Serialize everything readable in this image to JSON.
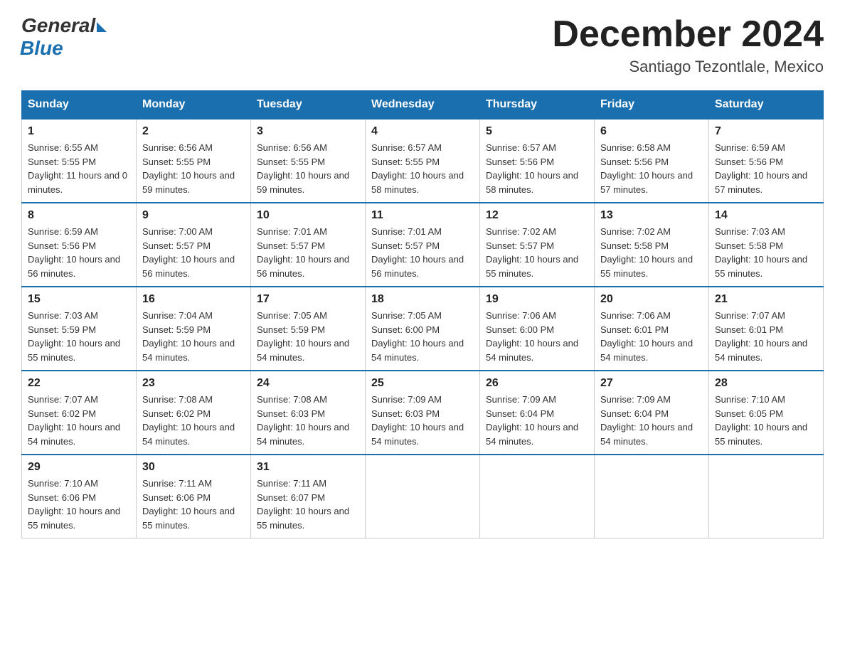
{
  "logo": {
    "general": "General",
    "blue": "Blue"
  },
  "title": "December 2024",
  "location": "Santiago Tezontlale, Mexico",
  "days_of_week": [
    "Sunday",
    "Monday",
    "Tuesday",
    "Wednesday",
    "Thursday",
    "Friday",
    "Saturday"
  ],
  "weeks": [
    [
      {
        "day": "1",
        "sunrise": "6:55 AM",
        "sunset": "5:55 PM",
        "daylight": "11 hours and 0 minutes."
      },
      {
        "day": "2",
        "sunrise": "6:56 AM",
        "sunset": "5:55 PM",
        "daylight": "10 hours and 59 minutes."
      },
      {
        "day": "3",
        "sunrise": "6:56 AM",
        "sunset": "5:55 PM",
        "daylight": "10 hours and 59 minutes."
      },
      {
        "day": "4",
        "sunrise": "6:57 AM",
        "sunset": "5:55 PM",
        "daylight": "10 hours and 58 minutes."
      },
      {
        "day": "5",
        "sunrise": "6:57 AM",
        "sunset": "5:56 PM",
        "daylight": "10 hours and 58 minutes."
      },
      {
        "day": "6",
        "sunrise": "6:58 AM",
        "sunset": "5:56 PM",
        "daylight": "10 hours and 57 minutes."
      },
      {
        "day": "7",
        "sunrise": "6:59 AM",
        "sunset": "5:56 PM",
        "daylight": "10 hours and 57 minutes."
      }
    ],
    [
      {
        "day": "8",
        "sunrise": "6:59 AM",
        "sunset": "5:56 PM",
        "daylight": "10 hours and 56 minutes."
      },
      {
        "day": "9",
        "sunrise": "7:00 AM",
        "sunset": "5:57 PM",
        "daylight": "10 hours and 56 minutes."
      },
      {
        "day": "10",
        "sunrise": "7:01 AM",
        "sunset": "5:57 PM",
        "daylight": "10 hours and 56 minutes."
      },
      {
        "day": "11",
        "sunrise": "7:01 AM",
        "sunset": "5:57 PM",
        "daylight": "10 hours and 56 minutes."
      },
      {
        "day": "12",
        "sunrise": "7:02 AM",
        "sunset": "5:57 PM",
        "daylight": "10 hours and 55 minutes."
      },
      {
        "day": "13",
        "sunrise": "7:02 AM",
        "sunset": "5:58 PM",
        "daylight": "10 hours and 55 minutes."
      },
      {
        "day": "14",
        "sunrise": "7:03 AM",
        "sunset": "5:58 PM",
        "daylight": "10 hours and 55 minutes."
      }
    ],
    [
      {
        "day": "15",
        "sunrise": "7:03 AM",
        "sunset": "5:59 PM",
        "daylight": "10 hours and 55 minutes."
      },
      {
        "day": "16",
        "sunrise": "7:04 AM",
        "sunset": "5:59 PM",
        "daylight": "10 hours and 54 minutes."
      },
      {
        "day": "17",
        "sunrise": "7:05 AM",
        "sunset": "5:59 PM",
        "daylight": "10 hours and 54 minutes."
      },
      {
        "day": "18",
        "sunrise": "7:05 AM",
        "sunset": "6:00 PM",
        "daylight": "10 hours and 54 minutes."
      },
      {
        "day": "19",
        "sunrise": "7:06 AM",
        "sunset": "6:00 PM",
        "daylight": "10 hours and 54 minutes."
      },
      {
        "day": "20",
        "sunrise": "7:06 AM",
        "sunset": "6:01 PM",
        "daylight": "10 hours and 54 minutes."
      },
      {
        "day": "21",
        "sunrise": "7:07 AM",
        "sunset": "6:01 PM",
        "daylight": "10 hours and 54 minutes."
      }
    ],
    [
      {
        "day": "22",
        "sunrise": "7:07 AM",
        "sunset": "6:02 PM",
        "daylight": "10 hours and 54 minutes."
      },
      {
        "day": "23",
        "sunrise": "7:08 AM",
        "sunset": "6:02 PM",
        "daylight": "10 hours and 54 minutes."
      },
      {
        "day": "24",
        "sunrise": "7:08 AM",
        "sunset": "6:03 PM",
        "daylight": "10 hours and 54 minutes."
      },
      {
        "day": "25",
        "sunrise": "7:09 AM",
        "sunset": "6:03 PM",
        "daylight": "10 hours and 54 minutes."
      },
      {
        "day": "26",
        "sunrise": "7:09 AM",
        "sunset": "6:04 PM",
        "daylight": "10 hours and 54 minutes."
      },
      {
        "day": "27",
        "sunrise": "7:09 AM",
        "sunset": "6:04 PM",
        "daylight": "10 hours and 54 minutes."
      },
      {
        "day": "28",
        "sunrise": "7:10 AM",
        "sunset": "6:05 PM",
        "daylight": "10 hours and 55 minutes."
      }
    ],
    [
      {
        "day": "29",
        "sunrise": "7:10 AM",
        "sunset": "6:06 PM",
        "daylight": "10 hours and 55 minutes."
      },
      {
        "day": "30",
        "sunrise": "7:11 AM",
        "sunset": "6:06 PM",
        "daylight": "10 hours and 55 minutes."
      },
      {
        "day": "31",
        "sunrise": "7:11 AM",
        "sunset": "6:07 PM",
        "daylight": "10 hours and 55 minutes."
      },
      null,
      null,
      null,
      null
    ]
  ]
}
